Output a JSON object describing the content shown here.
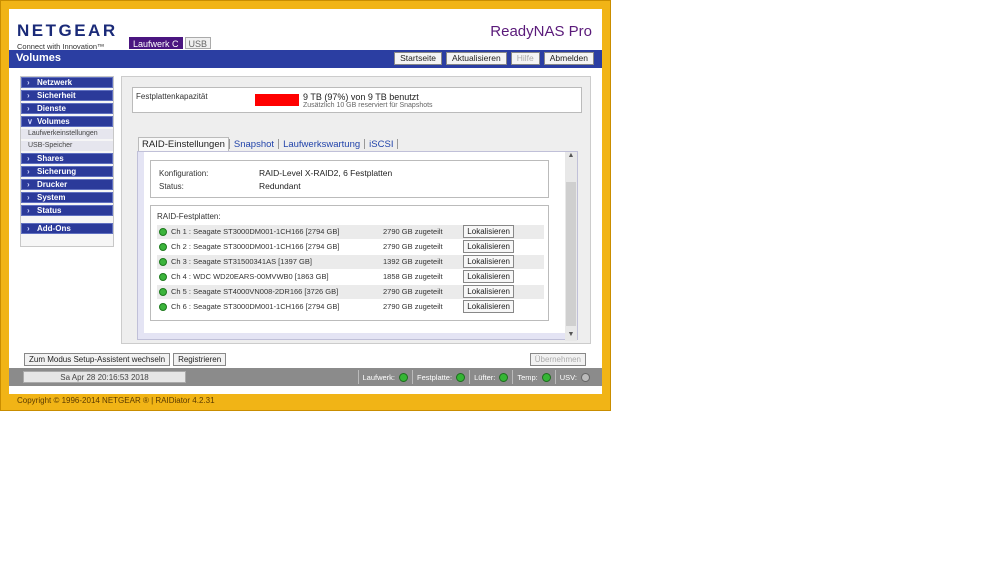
{
  "logo": {
    "brand": "NETGEAR",
    "tagline": "Connect with Innovation™"
  },
  "product": "ReadyNAS Pro",
  "volume_tabs": [
    {
      "label": "Laufwerk C",
      "active": true
    },
    {
      "label": "USB",
      "active": false
    }
  ],
  "header": {
    "title": "Volumes",
    "buttons": [
      {
        "label": "Startseite"
      },
      {
        "label": "Aktualisieren"
      },
      {
        "label": "Hilfe"
      },
      {
        "label": "Abmelden"
      }
    ]
  },
  "nav": {
    "items": [
      {
        "label": "Netzwerk"
      },
      {
        "label": "Sicherheit"
      },
      {
        "label": "Dienste"
      },
      {
        "label": "Volumes"
      },
      {
        "label": "Shares"
      },
      {
        "label": "Sicherung"
      },
      {
        "label": "Drucker"
      },
      {
        "label": "System"
      },
      {
        "label": "Status"
      },
      {
        "label": "Add-Ons"
      }
    ],
    "subitems": [
      {
        "label": "Laufwerkeinstellungen"
      },
      {
        "label": "USB-Speicher"
      }
    ]
  },
  "capacity": {
    "label": "Festplattenkapazität",
    "used_fraction": 0.97,
    "text": "9 TB (97%) von 9 TB benutzt",
    "subtext": "Zusätzlich 10 GB reserviert für Snapshots"
  },
  "tabs": [
    {
      "label": "RAID-Einstellungen"
    },
    {
      "label": "Snapshot"
    },
    {
      "label": "Laufwerkswartung"
    },
    {
      "label": "iSCSI"
    }
  ],
  "config": {
    "config_label": "Konfiguration:",
    "config_value": "RAID-Level X-RAID2, 6 Festplatten",
    "status_label": "Status:",
    "status_value": "Redundant"
  },
  "disks": {
    "title": "RAID-Festplatten:",
    "button_label": "Lokalisieren",
    "rows": [
      {
        "name": "Ch 1 : Seagate ST3000DM001-1CH166 [2794 GB]",
        "alloc": "2790 GB zugeteilt"
      },
      {
        "name": "Ch 2 : Seagate ST3000DM001-1CH166 [2794 GB]",
        "alloc": "2790 GB zugeteilt"
      },
      {
        "name": "Ch 3 : Seagate ST31500341AS [1397 GB]",
        "alloc": "1392 GB zugeteilt"
      },
      {
        "name": "Ch 4 : WDC WD20EARS-00MVWB0 [1863 GB]",
        "alloc": "1858 GB zugeteilt"
      },
      {
        "name": "Ch 5 : Seagate ST4000VN008-2DR166 [3726 GB]",
        "alloc": "2790 GB zugeteilt"
      },
      {
        "name": "Ch 6 : Seagate ST3000DM001-1CH166 [2794 GB]",
        "alloc": "2790 GB zugeteilt"
      }
    ]
  },
  "bottom": {
    "wizard": "Zum Modus Setup-Assistent wechseln",
    "register": "Registrieren",
    "apply": "Übernehmen"
  },
  "status_bar": {
    "datetime": "Sa Apr 28  20:16:53 2018",
    "indicators": [
      {
        "label": "Laufwerk:",
        "state": "green"
      },
      {
        "label": "Festplatte:",
        "state": "green"
      },
      {
        "label": "Lüfter:",
        "state": "green"
      },
      {
        "label": "Temp:",
        "state": "green"
      },
      {
        "label": "USV:",
        "state": "gray"
      }
    ]
  },
  "copyright": "Copyright © 1996-2014 NETGEAR ® | RAIDiator 4.2.31"
}
